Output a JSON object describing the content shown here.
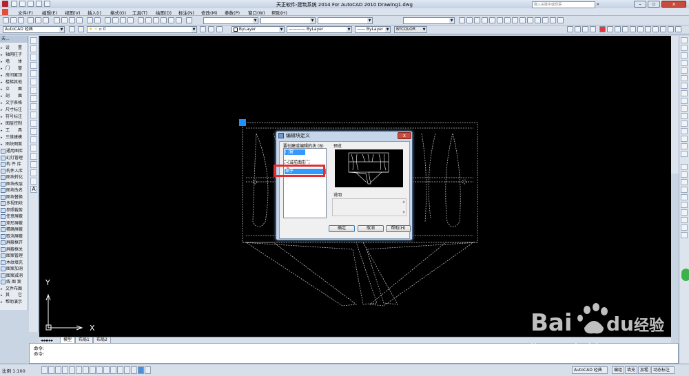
{
  "window": {
    "title": "天正软件-建筑系统 2014  For AutoCAD 2010    Drawing1.dwg",
    "search_placeholder": "键入关键字或短语"
  },
  "menus": [
    "文件(F)",
    "编辑(E)",
    "视图(V)",
    "插入(I)",
    "格式(O)",
    "工具(T)",
    "绘图(D)",
    "标注(N)",
    "修改(M)",
    "参数(P)",
    "窗口(W)",
    "帮助(H)"
  ],
  "toolbar": {
    "workspace": "AutoCAD 经典",
    "layer": "0",
    "color": "ByLayer",
    "linetype": "ByLayer",
    "lineweight": "ByLayer",
    "plotstyle": "BYCOLOR"
  },
  "palette": {
    "header": "天...",
    "items": [
      {
        "label": "设　　置",
        "type": "menu"
      },
      {
        "label": "轴网柱子",
        "type": "menu"
      },
      {
        "label": "墙　　体",
        "type": "menu"
      },
      {
        "label": "门　　窗",
        "type": "menu"
      },
      {
        "label": "房间屋顶",
        "type": "menu"
      },
      {
        "label": "楼梯其他",
        "type": "menu"
      },
      {
        "label": "立　　面",
        "type": "menu"
      },
      {
        "label": "剖　　面",
        "type": "menu"
      },
      {
        "label": "文字表格",
        "type": "menu"
      },
      {
        "label": "尺寸标注",
        "type": "menu"
      },
      {
        "label": "符号标注",
        "type": "menu"
      },
      {
        "label": "图层控制",
        "type": "menu"
      },
      {
        "label": "工　　具",
        "type": "menu"
      },
      {
        "label": "三维建模",
        "type": "menu"
      },
      {
        "label": "图块图案",
        "type": "menu"
      },
      {
        "label": "通用图库",
        "type": "cmd"
      },
      {
        "label": "幻灯管理",
        "type": "cmd"
      },
      {
        "label": "构 件 库",
        "type": "cmd"
      },
      {
        "label": "构件入库",
        "type": "cmd"
      },
      {
        "label": "图块转化",
        "type": "cmd"
      },
      {
        "label": "图块改层",
        "type": "cmd"
      },
      {
        "label": "图块改名",
        "type": "cmd"
      },
      {
        "label": "图块替换",
        "type": "cmd"
      },
      {
        "label": "多视图块",
        "type": "cmd"
      },
      {
        "label": "参照裁剪",
        "type": "cmd"
      },
      {
        "label": "任意屏蔽",
        "type": "cmd"
      },
      {
        "label": "矩形屏蔽",
        "type": "cmd"
      },
      {
        "label": "精确屏蔽",
        "type": "cmd"
      },
      {
        "label": "取消屏蔽",
        "type": "cmd"
      },
      {
        "label": "屏蔽框开",
        "type": "cmd"
      },
      {
        "label": "屏蔽框关",
        "type": "cmd"
      },
      {
        "label": "图案管理",
        "type": "cmd"
      },
      {
        "label": "木纹填充",
        "type": "cmd"
      },
      {
        "label": "图案加洞",
        "type": "cmd"
      },
      {
        "label": "图案减洞",
        "type": "cmd"
      },
      {
        "label": "线 图 案",
        "type": "cmd"
      },
      {
        "label": "文件布图",
        "type": "menu"
      },
      {
        "label": "其　　它",
        "type": "menu"
      },
      {
        "label": "帮助演示",
        "type": "menu"
      }
    ]
  },
  "dialog": {
    "title": "编辑块定义",
    "close_label": "x",
    "list_label": "要创建或编辑的块 (B)",
    "list_items": [
      "门窗",
      "<当前图形>",
      "裙子"
    ],
    "preview_label": "预览",
    "desc_label": "说明",
    "ok_label": "确定",
    "cancel_label": "取消",
    "help_label": "帮助(H)"
  },
  "ucs": {
    "y_label": "Y",
    "x_label": "X"
  },
  "tabs": [
    "模型",
    "布局1",
    "布局2"
  ],
  "command_lines": [
    "命令:",
    "命令:"
  ],
  "status": {
    "scale": "比例 1:100",
    "right_items": [
      "AutoCAD 经典",
      "编组",
      "填充",
      "加粗",
      "动态标注"
    ]
  },
  "watermark": {
    "brand": "Bai",
    "brand2": "du",
    "cn": "经验",
    "url": "jingyan.baidu.com"
  }
}
